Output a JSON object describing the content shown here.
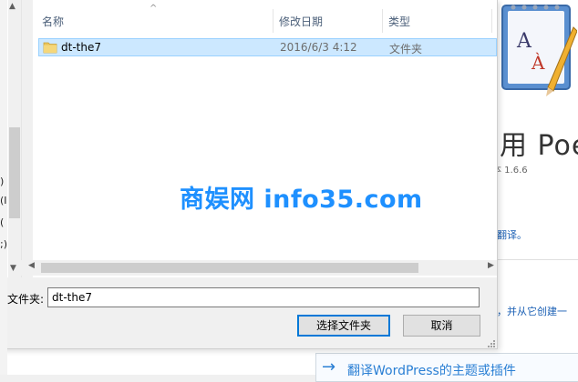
{
  "background_app": {
    "title_fragment": "用 Poec",
    "version_fragment": "本 1.6.6",
    "link_fragment_1": "翻译。",
    "link_fragment_2": "，并从它创建一",
    "bottom_button_label": "翻译WordPress的主题或插件",
    "left_strip_glyphs": [
      ")",
      "(I",
      "(",
      ";)"
    ]
  },
  "dialog": {
    "columns": {
      "name": "名称",
      "date": "修改日期",
      "type": "类型"
    },
    "rows": [
      {
        "name": "dt-the7",
        "date": "2016/6/3 4:12",
        "type": "文件夹"
      }
    ],
    "folder_label": "文件夹:",
    "folder_value": "dt-the7",
    "select_folder_label": "选择文件夹",
    "cancel_label": "取消",
    "left_pane_glyphs": [
      ")",
      "(I",
      "(",
      ";)"
    ]
  },
  "watermark": "商娱网 info35.com",
  "icons": {
    "folder": "folder-icon",
    "sort": "sort-up-icon",
    "scroll_up": "scroll-up-icon",
    "scroll_down": "scroll-down-icon",
    "scroll_left": "scroll-left-icon",
    "scroll_right": "scroll-right-icon",
    "arrow": "arrow-right-icon",
    "logo": "poedit-logo-icon"
  },
  "colors": {
    "selection_bg": "#cce8ff",
    "selection_border": "#99d1ff",
    "header_text": "#4c607a",
    "link": "#1a5fb4",
    "accent": "#0078d7",
    "folder_yellow": "#e8c35a",
    "watermark": "#1e90ff"
  }
}
